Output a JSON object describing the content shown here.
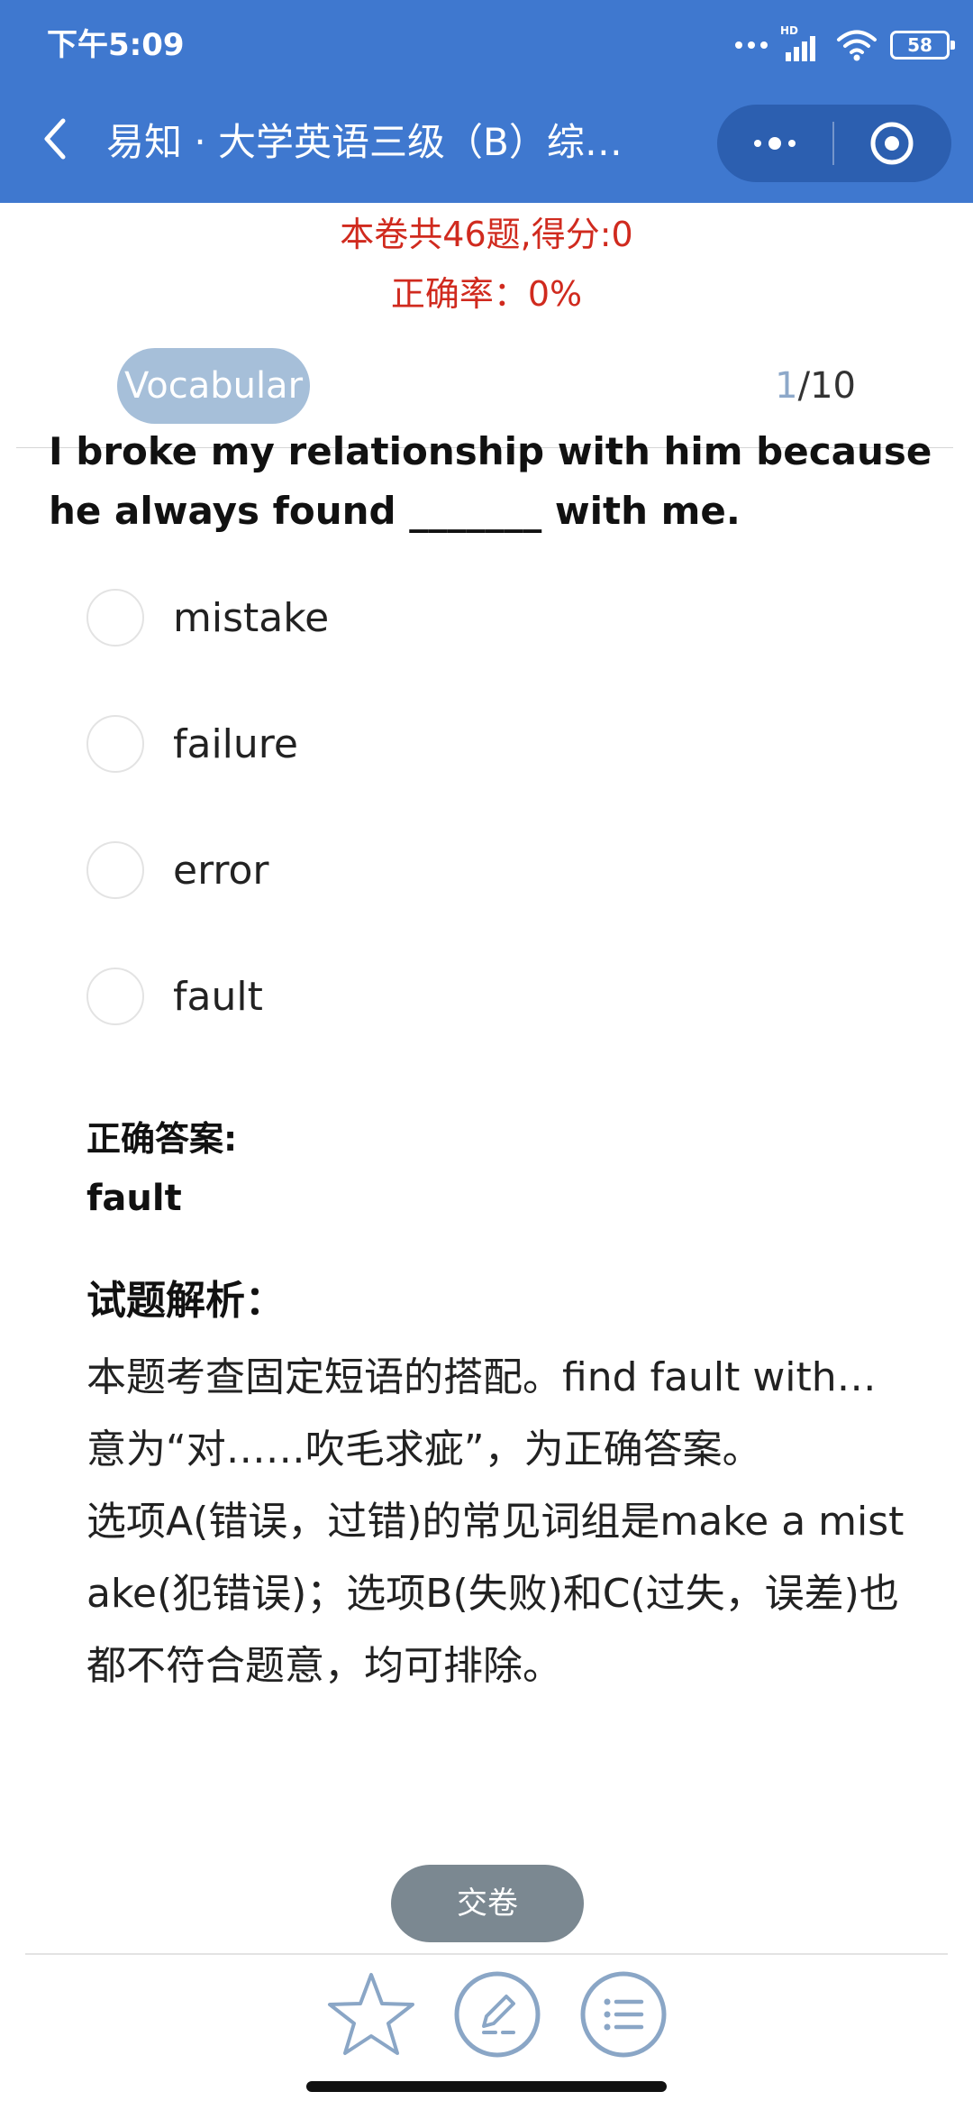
{
  "status_bar": {
    "time": "下午5:09",
    "network_badge": "HD",
    "battery": "58"
  },
  "nav": {
    "title": "易知 · 大学英语三级（B）综…",
    "back_icon": "chevron-left-icon",
    "more_icon": "more-dots-icon",
    "close_icon": "target-circle-icon"
  },
  "score": {
    "summary": "本卷共46题,得分:0",
    "accuracy": "正确率：0%"
  },
  "question": {
    "category": "Vocabular",
    "current": "1",
    "total": "/10",
    "text": "I broke my relationship with him because he always found _______ with me.",
    "options": [
      "mistake",
      "failure",
      "error",
      "fault"
    ]
  },
  "answer": {
    "label": "正确答案:",
    "value": "fault"
  },
  "analysis": {
    "title": "试题解析：",
    "paragraph1": "本题考查固定短语的搭配。find fault with…意为“对……吹毛求疵”，为正确答案。",
    "paragraph2": "选项A(错误，过错)的常见词组是make a mistake(犯错误)；选项B(失败)和C(过失，误差)也都不符合题意，均可排除。"
  },
  "footer": {
    "submit_label": "交卷",
    "tools": [
      "star-icon",
      "pencil-edit-icon",
      "list-menu-icon"
    ]
  },
  "colors": {
    "header_blue": "#3f78cf",
    "capsule_blue": "#2c5fb0",
    "score_red": "#d02a1e",
    "pill_blue": "#a6bfd9",
    "submit_gray": "#7b8891",
    "tool_blue": "#8aa6c6"
  }
}
